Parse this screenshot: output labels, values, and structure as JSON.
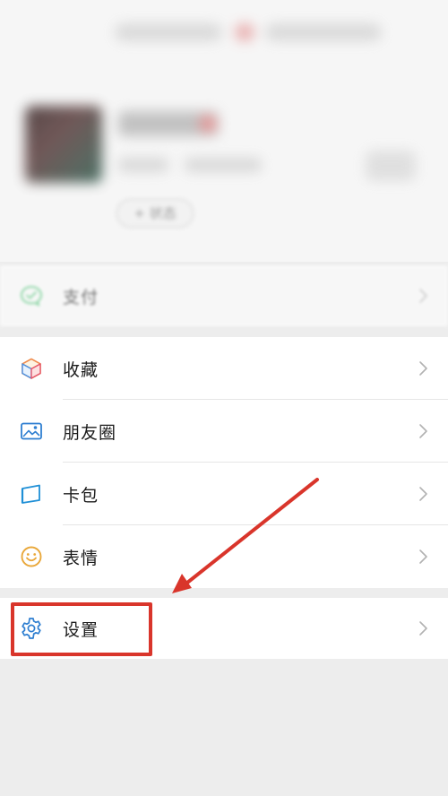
{
  "profile": {
    "status_button_label": "+ 状态"
  },
  "groups": {
    "pay": {
      "label": "支付"
    },
    "main": [
      {
        "label": "收藏"
      },
      {
        "label": "朋友圈"
      },
      {
        "label": "卡包"
      },
      {
        "label": "表情"
      }
    ],
    "settings": {
      "label": "设置"
    }
  },
  "icons": {
    "pay": "pay-icon",
    "favorites": "cube-icon",
    "moments": "image-icon",
    "cards": "card-icon",
    "stickers": "smiley-icon",
    "settings": "gear-icon",
    "chevron": "chevron-right-icon"
  },
  "colors": {
    "background": "#ededed",
    "surface": "#ffffff",
    "annotation_red": "#d9352b",
    "pay_green": "#3cc26a",
    "moments_blue": "#2f7fd1",
    "cards_blue": "#1f8fd6",
    "stickers_yellow": "#e9a83b",
    "settings_blue": "#2f7fd1"
  }
}
